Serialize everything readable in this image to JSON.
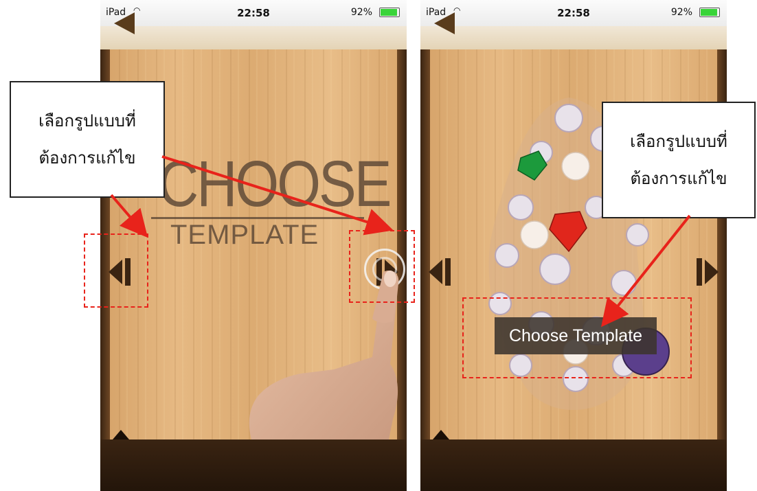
{
  "status_bar": {
    "carrier": "iPad",
    "time": "22:58",
    "battery": "92%",
    "battery_level": 0.92
  },
  "left_screen": {
    "title_choose": "CHOOSE",
    "title_template": "TEMPLATE"
  },
  "right_screen": {
    "button_label": "Choose Template"
  },
  "annotations": {
    "callout_line1": "เลือกรูปแบบที่",
    "callout_line2": "ต้องการแก้ไข",
    "highlight_color": "#e8231b"
  },
  "colors": {
    "wood": "#e0b07a",
    "frame": "#3a2412",
    "battery": "#39d439"
  },
  "icons": [
    "back-arrow-icon",
    "wifi-icon",
    "battery-icon",
    "previous-template-icon",
    "next-template-icon"
  ]
}
